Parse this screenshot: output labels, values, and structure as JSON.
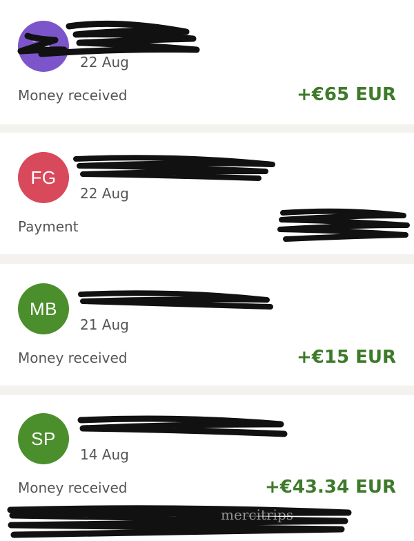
{
  "transactions": [
    {
      "initials": "ZK",
      "avatar_color": "#7b55c9",
      "date": "22 Aug",
      "type": "Money received",
      "amount": "+€65 EUR"
    },
    {
      "initials": "FG",
      "avatar_color": "#d8495c",
      "date": "22 Aug",
      "type": "Payment",
      "amount": ""
    },
    {
      "initials": "MB",
      "avatar_color": "#4b8f2c",
      "date": "21 Aug",
      "type": "Money received",
      "amount": "+€15 EUR"
    },
    {
      "initials": "SP",
      "avatar_color": "#4b8f2c",
      "date": "14 Aug",
      "type": "Money received",
      "amount": "+€43.34 EUR"
    }
  ],
  "colors": {
    "amount_positive": "#3d7a2a",
    "background": "#f3f2ee",
    "redaction": "#111111"
  },
  "watermark": "mercitrips"
}
